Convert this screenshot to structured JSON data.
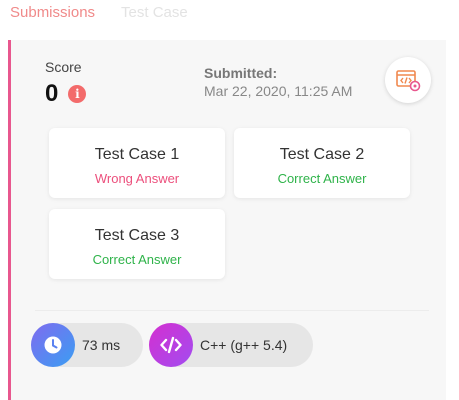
{
  "tabs": [
    {
      "label": "Submissions",
      "active": true
    },
    {
      "label": "Test Case",
      "active": false
    }
  ],
  "score": {
    "label": "Score",
    "value": "0",
    "info_icon": "i"
  },
  "submitted": {
    "label": "Submitted:",
    "date": "Mar 22, 2020, 11:25 AM"
  },
  "code_button_icon": "code-settings-icon",
  "test_cases": [
    {
      "title": "Test Case 1",
      "result": "Wrong Answer",
      "status": "wrong"
    },
    {
      "title": "Test Case 2",
      "result": "Correct Answer",
      "status": "correct"
    },
    {
      "title": "Test Case 3",
      "result": "Correct Answer",
      "status": "correct"
    }
  ],
  "runtime": {
    "icon": "clock-icon",
    "value": "73 ms"
  },
  "language": {
    "icon": "code-icon",
    "value": "C++ (g++ 5.4)"
  },
  "colors": {
    "accent": "#e8578e",
    "tab_active": "#f08a8a",
    "wrong": "#ec4f7c",
    "correct": "#2fb34a",
    "info": "#f36b6b"
  }
}
